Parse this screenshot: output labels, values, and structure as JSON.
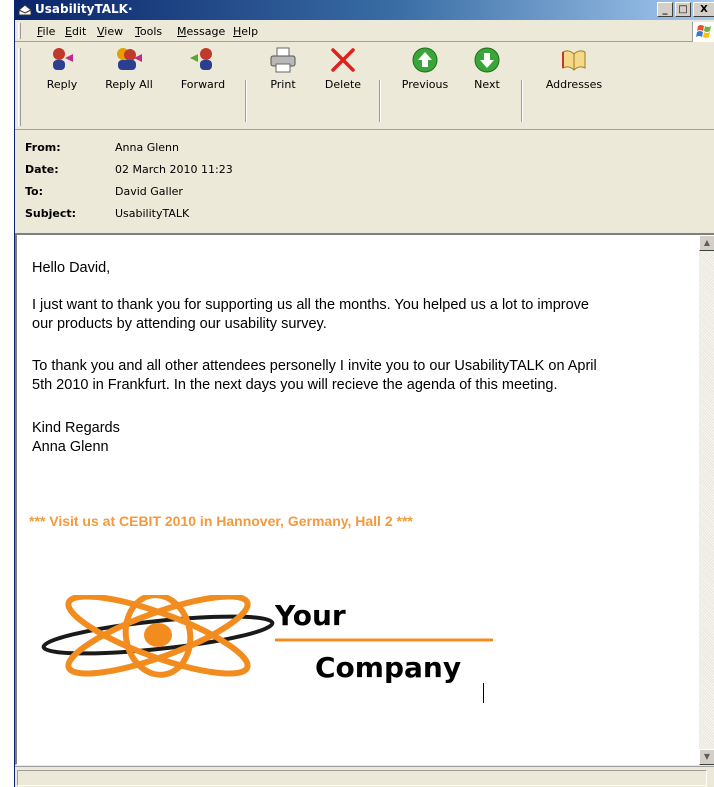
{
  "window": {
    "title": "UsabilityTALK·"
  },
  "titlebar_buttons": {
    "minimize": "_",
    "maximize": "□",
    "close": "X"
  },
  "menu": [
    {
      "label": "File",
      "accel": "F",
      "rest": "ile"
    },
    {
      "label": "Edit",
      "accel": "E",
      "rest": "dit"
    },
    {
      "label": "View",
      "accel": "V",
      "rest": "iew"
    },
    {
      "label": "Tools",
      "accel": "T",
      "rest": "ools"
    },
    {
      "label": "Message",
      "accel": "M",
      "rest": "essage"
    },
    {
      "label": "Help",
      "accel": "H",
      "rest": "elp"
    }
  ],
  "toolbar": {
    "reply": "Reply",
    "reply_all": "Reply All",
    "forward": "Forward",
    "print": "Print",
    "delete": "Delete",
    "previous": "Previous",
    "next": "Next",
    "addresses": "Addresses"
  },
  "icons": {
    "reply": "reply-icon",
    "reply_all": "reply-all-icon",
    "forward": "forward-icon",
    "print": "printer-icon",
    "delete": "delete-x-icon",
    "previous": "arrow-up-icon",
    "next": "arrow-down-icon",
    "addresses": "address-book-icon"
  },
  "header": {
    "from_label": "From:",
    "from": "Anna Glenn",
    "date_label": "Date:",
    "date": "02 March 2010 11:23",
    "to_label": "To:",
    "to": "David Galler",
    "subject_label": "Subject:",
    "subject": "UsabilityTALK"
  },
  "body": {
    "greeting": "Hello David,",
    "p1_line1": "I just want to thank you for supporting us all the months. You helped us a lot to improve",
    "p1_line2": "our products by attending our usability survey.",
    "p2_line1": "To thank you and all other attendees personelly I invite you to our UsabilityTALK on April",
    "p2_line2": "5th 2010 in Frankfurt. In the next days you will recieve the agenda of this meeting.",
    "closing": "Kind Regards",
    "signature": "Anna Glenn",
    "promo": "***   Visit us at CEBIT 2010 in Hannover, Germany, Hall 2   ***"
  },
  "logo": {
    "line1": "Your",
    "line2": "Company"
  },
  "colors": {
    "promo": "#f39a3c",
    "logo_orange": "#f28c1e",
    "titlebar": "#0a246a"
  }
}
